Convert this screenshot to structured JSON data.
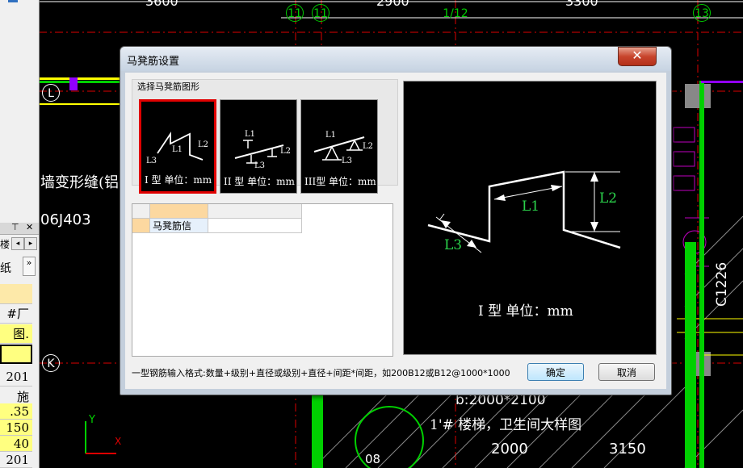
{
  "dialog": {
    "title": "马凳筋设置",
    "close_glyph": "✕",
    "shape_group_label": "选择马凳筋图形",
    "shapes": [
      {
        "caption": "I 型  单位：mm",
        "selected": true,
        "labels": [
          "L1",
          "L2",
          "L3"
        ]
      },
      {
        "caption": "II 型  单位：mm",
        "selected": false,
        "labels": [
          "L1",
          "L2",
          "L3"
        ]
      },
      {
        "caption": "III型  单位：mm",
        "selected": false,
        "labels": [
          "L1",
          "L2",
          "L3"
        ]
      }
    ],
    "grid": {
      "row_label": "马凳筋信",
      "value": ""
    },
    "preview": {
      "caption": "I 型  单位：mm",
      "labels": {
        "l1": "L1",
        "l2": "L2",
        "l3": "L3"
      }
    },
    "hint": "一型钢筋输入格式:数量+级别+直径或级别+直径+间距*间距，如200B12或B12@1000*1000",
    "ok_label": "确定",
    "cancel_label": "取消"
  },
  "left_panel": {
    "close_x": "✕",
    "pin": "⊤",
    "nav_left": "◂",
    "nav_right": "▸",
    "chevron": "»",
    "tab_fragment_1": "楼",
    "tab_fragment_2": "纸",
    "rows": [
      "#厂",
      "图.",
      "",
      "201",
      "施",
      ".35",
      "150",
      "40",
      "201"
    ]
  },
  "cad": {
    "top_dims": [
      "3600",
      "2900",
      "3300"
    ],
    "axes_top": [
      "11",
      "11",
      "1/12",
      "13"
    ],
    "axis_left_1": "L",
    "axis_left_2": "K",
    "text_wall": "墙变形缝(铝",
    "text_code": "06J403",
    "text_bottom_title": "1'# 楼梯，卫生间大样图",
    "text_dim_1": "b:2000*2100",
    "text_dim_2": "2000",
    "text_dim_3": "3150",
    "text_c1226": "C1226",
    "text_08": "08",
    "text_dialog_bg": "C0??",
    "ucs_y": "Y",
    "ucs_x": "X"
  },
  "colors": {
    "accent_red": "#e00000",
    "cad_green": "#00d000",
    "cad_yellow": "#ffff00",
    "cad_magenta": "#b000ff"
  }
}
